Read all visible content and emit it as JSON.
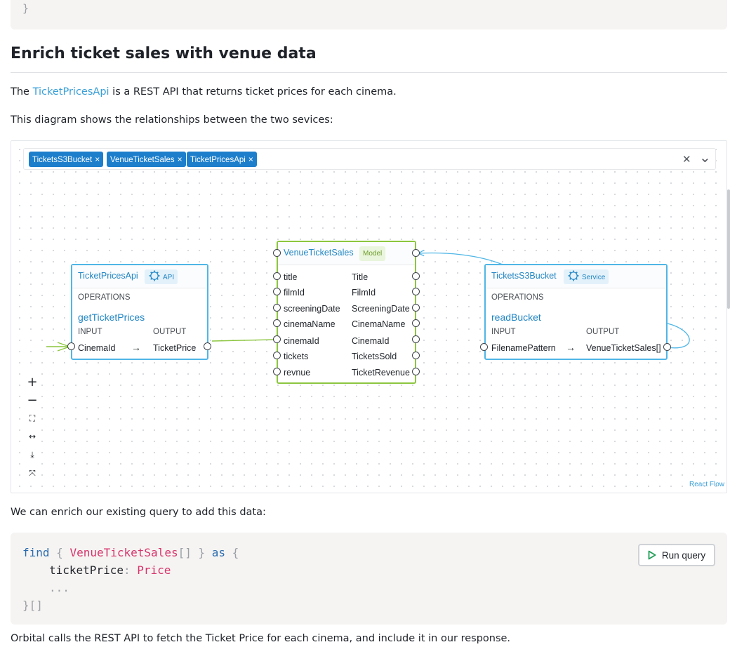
{
  "top_code": {
    "closing_brace": "}"
  },
  "heading": "Enrich ticket sales with venue data",
  "intro": {
    "prefix": "The ",
    "link": "TicketPricesApi",
    "suffix": " is a REST API that returns ticket prices for each cinema."
  },
  "diagram_intro": "This diagram shows the relationships between the two sevices:",
  "selector": {
    "chips": [
      "TicketsS3Bucket",
      "VenueTicketSales",
      "TicketPricesApi"
    ],
    "chip_remove_glyph": "×",
    "clear_glyph": "✕",
    "caret_glyph": "⌄"
  },
  "nodes": {
    "api": {
      "title": "TicketPricesApi",
      "badge": "API",
      "operations_label": "OPERATIONS",
      "operation": "getTicketPrices",
      "input_label": "INPUT",
      "output_label": "OUTPUT",
      "input": "CinemaId",
      "arrow": "→",
      "output": "TicketPrice"
    },
    "model": {
      "title": "VenueTicketSales",
      "badge": "Model",
      "fields": [
        {
          "left": "title",
          "right": "Title"
        },
        {
          "left": "filmId",
          "right": "FilmId"
        },
        {
          "left": "screeningDate",
          "right": "ScreeningDate"
        },
        {
          "left": "cinemaName",
          "right": "CinemaName"
        },
        {
          "left": "cinemaId",
          "right": "CinemaId"
        },
        {
          "left": "tickets",
          "right": "TicketsSold"
        },
        {
          "left": "revnue",
          "right": "TicketRevenue"
        }
      ]
    },
    "service": {
      "title": "TicketsS3Bucket",
      "badge": "Service",
      "operations_label": "OPERATIONS",
      "operation": "readBucket",
      "input_label": "INPUT",
      "output_label": "OUTPUT",
      "input": "FilenamePattern",
      "arrow": "→",
      "output": "VenueTicketSales[]"
    }
  },
  "controls": [
    {
      "name": "zoom-in",
      "glyph": "+"
    },
    {
      "name": "zoom-out",
      "glyph": "−"
    },
    {
      "name": "fit-view",
      "glyph": "⛶"
    },
    {
      "name": "fit-width",
      "glyph": "↔"
    },
    {
      "name": "download",
      "glyph": "⤓"
    },
    {
      "name": "collapse",
      "glyph": "⤧"
    }
  ],
  "attribution": "React Flow",
  "colors": {
    "accent": "#3a9fd8",
    "api_border": "#4fb6e6",
    "model_border": "#8cc63f",
    "edge_green": "#8cc63f",
    "edge_blue": "#4fb6e6"
  },
  "enrich_text": "We can enrich our existing query to add this data:",
  "query": {
    "find": "find",
    "open_brace": "{",
    "type": "VenueTicketSales",
    "array": "[]",
    "close_brace": "}",
    "as": "as",
    "open2": "{",
    "field": "ticketPrice",
    "colon": ":",
    "field_type": "Price",
    "ellipsis": "...",
    "closing": "}[]"
  },
  "run_button": "Run query",
  "closing_text": "Orbital calls the REST API to fetch the Ticket Price for each cinema, and include it in our response."
}
